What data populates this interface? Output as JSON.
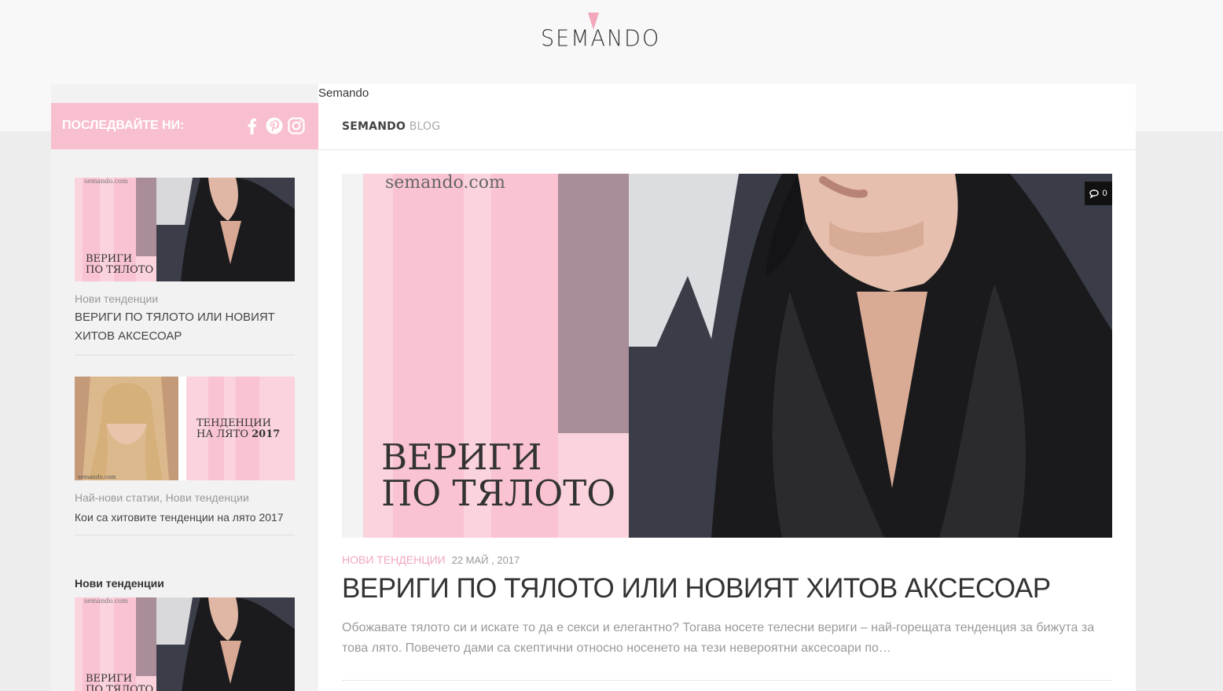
{
  "brand": {
    "logo_text": "SEMANDO",
    "accent_color": "#f8bfce",
    "logo_mark_color": "#f2a7bb"
  },
  "sidebar": {
    "follow_label": "ПОСЛЕДВАЙТЕ НИ:",
    "social_icons": [
      "facebook-icon",
      "pinterest-icon",
      "instagram-icon"
    ],
    "posts": [
      {
        "image_watermark": "semando.com",
        "image_caption_line1": "ВЕРИГИ",
        "image_caption_line2": "ПО ТЯЛОТО",
        "categories": "Нови тенденции",
        "title": "ВЕРИГИ ПО ТЯЛОТО ИЛИ НОВИЯТ ХИТОВ АКСЕСОАР"
      },
      {
        "image_watermark": "semando.com",
        "image_caption_line1": "ТЕНДЕНЦИИ",
        "image_caption_line2_prefix": "НА ЛЯТО ",
        "image_caption_line2_year": "2017",
        "categories": "Най-нови статии, Нови тенденции",
        "title": "Кои са хитовите тенденции на лято 2017"
      }
    ],
    "widget_title": "Нови тенденции",
    "widget_post": {
      "image_watermark": "semando.com",
      "image_caption_line1": "ВЕРИГИ",
      "image_caption_line2": "ПО ТЯЛОТО"
    }
  },
  "main": {
    "site_label": "Semando",
    "nav": {
      "bold": "SEMANDO",
      "light": " BLOG"
    },
    "featured": {
      "image_watermark": "semando.com",
      "image_caption_line1": "ВЕРИГИ",
      "image_caption_line2": "ПО ТЯЛОТО",
      "comment_count": "0",
      "category": "НОВИ ТЕНДЕНЦИИ",
      "date": "22 МАЙ , 2017",
      "title": "ВЕРИГИ ПО ТЯЛОТО ИЛИ НОВИЯТ ХИТОВ АКСЕСОАР",
      "excerpt": "Обожавате тялото си и искате то да е секси и елегантно? Тогава носете телесни вериги – най-горещата тенденция за бижута за това лято. Повечето дами са скептични относно носенето на тези невероятни аксесоари по…"
    }
  }
}
